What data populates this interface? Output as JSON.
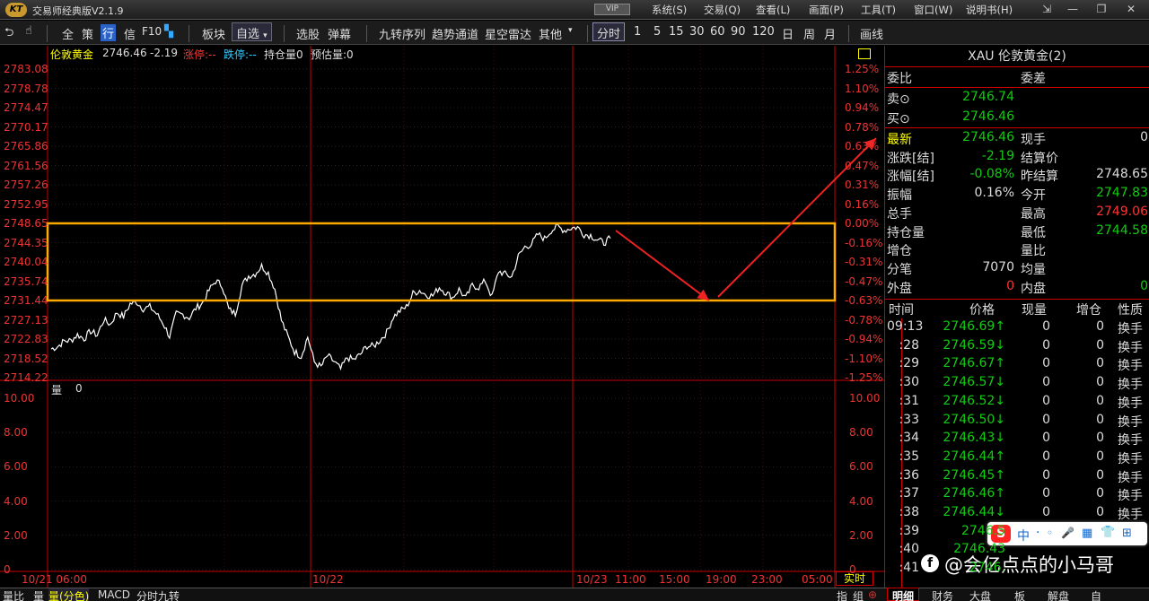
{
  "app": {
    "title": "交易师经典版V2.1.9",
    "logo_text": "KT",
    "vip": "VIP"
  },
  "menus": [
    "系统(S)",
    "交易(Q)",
    "查看(L)",
    "画面(P)",
    "工具(T)",
    "窗口(W)",
    "说明书(H)"
  ],
  "window_controls": [
    "⇲",
    "—",
    "❐",
    "✕"
  ],
  "toolbar": {
    "items": [
      "全",
      "策",
      "行",
      "信",
      "F10",
      "板块",
      "选股",
      "弹幕",
      "九转序列",
      "趋势通道",
      "星空雷达",
      "其他",
      "分时",
      "1",
      "5",
      "15",
      "30",
      "60",
      "90",
      "120",
      "日",
      "周",
      "月",
      "画线"
    ],
    "dropdown": "自选"
  },
  "info_bar": {
    "name": "伦敦黄金",
    "price": "2746.46",
    "change": "-2.19",
    "limit_up": "涨停:--",
    "limit_down": "跌停:--",
    "open_interest": "持仓量0",
    "estimate": "预估量:0"
  },
  "price_axis": {
    "left": [
      "2783.08",
      "2778.78",
      "2774.47",
      "2770.17",
      "2765.86",
      "2761.56",
      "2757.26",
      "2752.95",
      "2748.65",
      "2744.35",
      "2740.04",
      "2735.74",
      "2731.44",
      "2727.13",
      "2722.83",
      "2718.52",
      "2714.22"
    ],
    "right": [
      "1.25%",
      "1.10%",
      "0.94%",
      "0.78%",
      "0.63%",
      "0.47%",
      "0.31%",
      "0.16%",
      "0.00%",
      "-0.16%",
      "-0.31%",
      "-0.47%",
      "-0.63%",
      "-0.78%",
      "-0.94%",
      "-1.10%",
      "-1.25%"
    ]
  },
  "volume": {
    "label": "量",
    "value": "0",
    "axis": [
      "10.00",
      "8.00",
      "6.00",
      "4.00",
      "2.00",
      "0"
    ]
  },
  "x_axis": [
    "10/21 06:00",
    "10/22",
    "10/23",
    "11:00",
    "15:00",
    "19:00",
    "23:00",
    "05:00"
  ],
  "realtime_button": "实时",
  "bottom_tabs": [
    "量比",
    "量",
    "量(分色)",
    "MACD",
    "分时九转"
  ],
  "bottom_tabs_right": [
    "指",
    "组"
  ],
  "colors": {
    "up": "#ff3333",
    "down": "#22cc22",
    "axis": "#ee3333",
    "box": "#ffaa00",
    "arrow": "#ee2222",
    "price_line": "#ffffff"
  },
  "chart_data": {
    "type": "line",
    "series": [
      {
        "values": [
          2720.6,
          2721.2,
          2722.4,
          2722.5,
          2723.8,
          2722.9,
          2724.6,
          2723.7,
          2727.1,
          2726.1,
          2728.8,
          2727.8,
          2730.7,
          2731.1,
          2729.6,
          2730.0,
          2728.5,
          2726.4,
          2723.4,
          2728.4,
          2728.3,
          2727.6,
          2729.7,
          2730.9,
          2733.7,
          2735.8,
          2734.8,
          2729.4,
          2728.5,
          2734.8,
          2736.9,
          2737.4,
          2739.1,
          2737.6,
          2734.0,
          2727.0,
          2723.3,
          2720.0,
          2719.0,
          2723.3,
          2717.7,
          2716.6,
          2719.1,
          2717.8,
          2716.1,
          2718.7,
          2718.2,
          2719.4,
          2721.3,
          2721.2,
          2722.6,
          2724.3,
          2727.8,
          2729.1,
          2730.0,
          2733.0,
          2733.7,
          2732.7,
          2732.5,
          2734.4,
          2733.2,
          2732.1,
          2733.9,
          2731.9,
          2734.8,
          2734.4,
          2735.8,
          2732.2,
          2738.0,
          2737.3,
          2736.7,
          2741.3,
          2743.4,
          2744.0,
          2746.2,
          2745.2,
          2747.1,
          2747.9,
          2747.1,
          2747.6,
          2747.8,
          2746.2,
          2746.0,
          2745.0,
          2744.3,
          2745.3
        ]
      }
    ],
    "ylim": [
      2714.22,
      2783.08
    ],
    "xticks": [
      "10/21 06:00",
      "10/22",
      "10/23",
      "11:00",
      "15:00",
      "19:00",
      "23:00",
      "05:00"
    ],
    "highlight_range": [
      2731.44,
      2748.65
    ],
    "annotations": [
      "arrow down",
      "arrow up"
    ]
  },
  "right_panel": {
    "header": "XAU 伦敦黄金(2)",
    "weibi": "委比",
    "weicha": "委差",
    "sell": {
      "label": "卖⊙",
      "value": "2746.74"
    },
    "buy": {
      "label": "买⊙",
      "value": "2746.46"
    },
    "quotes": [
      {
        "l": "最新",
        "v": "2746.46",
        "l2": "现手",
        "v2": "0"
      },
      {
        "l": "涨跌[结]",
        "v": "-2.19",
        "l2": "结算价",
        "v2": ""
      },
      {
        "l": "涨幅[结]",
        "v": "-0.08%",
        "l2": "昨结算",
        "v2": "2748.65"
      },
      {
        "l": "振幅",
        "v": "0.16%",
        "l2": "今开",
        "v2": "2747.83"
      },
      {
        "l": "总手",
        "v": "",
        "l2": "最高",
        "v2": "2749.06"
      },
      {
        "l": "持仓量",
        "v": "",
        "l2": "最低",
        "v2": "2744.58"
      },
      {
        "l": "增仓",
        "v": "",
        "l2": "量比",
        "v2": ""
      },
      {
        "l": "分笔",
        "v": "7070",
        "l2": "均量",
        "v2": ""
      },
      {
        "l": "外盘",
        "v": "0",
        "l2": "内盘",
        "v2": "0"
      }
    ],
    "trade_headers": [
      "时间",
      "价格",
      "现量",
      "增仓",
      "性质"
    ],
    "trades": [
      {
        "t": "09:13",
        "p": "2746.69↑",
        "q": "0",
        "c": "0",
        "n": "换手"
      },
      {
        "t": ":28",
        "p": "2746.59↓",
        "q": "0",
        "c": "0",
        "n": "换手"
      },
      {
        "t": ":29",
        "p": "2746.67↑",
        "q": "0",
        "c": "0",
        "n": "换手"
      },
      {
        "t": ":30",
        "p": "2746.57↓",
        "q": "0",
        "c": "0",
        "n": "换手"
      },
      {
        "t": ":31",
        "p": "2746.52↓",
        "q": "0",
        "c": "0",
        "n": "换手"
      },
      {
        "t": ":33",
        "p": "2746.50↓",
        "q": "0",
        "c": "0",
        "n": "换手"
      },
      {
        "t": ":34",
        "p": "2746.43↓",
        "q": "0",
        "c": "0",
        "n": "换手"
      },
      {
        "t": ":35",
        "p": "2746.44↑",
        "q": "0",
        "c": "0",
        "n": "换手"
      },
      {
        "t": ":36",
        "p": "2746.45↑",
        "q": "0",
        "c": "0",
        "n": "换手"
      },
      {
        "t": ":37",
        "p": "2746.46↑",
        "q": "0",
        "c": "0",
        "n": "换手"
      },
      {
        "t": ":38",
        "p": "2746.44↓",
        "q": "0",
        "c": "0",
        "n": "换手"
      },
      {
        "t": ":39",
        "p": "2746.5",
        "q": "",
        "c": "",
        "n": ""
      },
      {
        "t": ":40",
        "p": "2746.43",
        "q": "",
        "c": "",
        "n": ""
      },
      {
        "t": ":41",
        "p": "2746.",
        "q": "",
        "c": "",
        "n": ""
      }
    ],
    "tabs": [
      "明细",
      "财务",
      "大盘",
      "板",
      "解盘",
      "自"
    ]
  },
  "watermark": {
    "text": "@会亿点点的小马哥"
  },
  "ime_bar": {
    "logo": "S",
    "items": [
      "中",
      "·",
      "◦",
      "🎤",
      "▦",
      "👕",
      "⊞"
    ]
  }
}
